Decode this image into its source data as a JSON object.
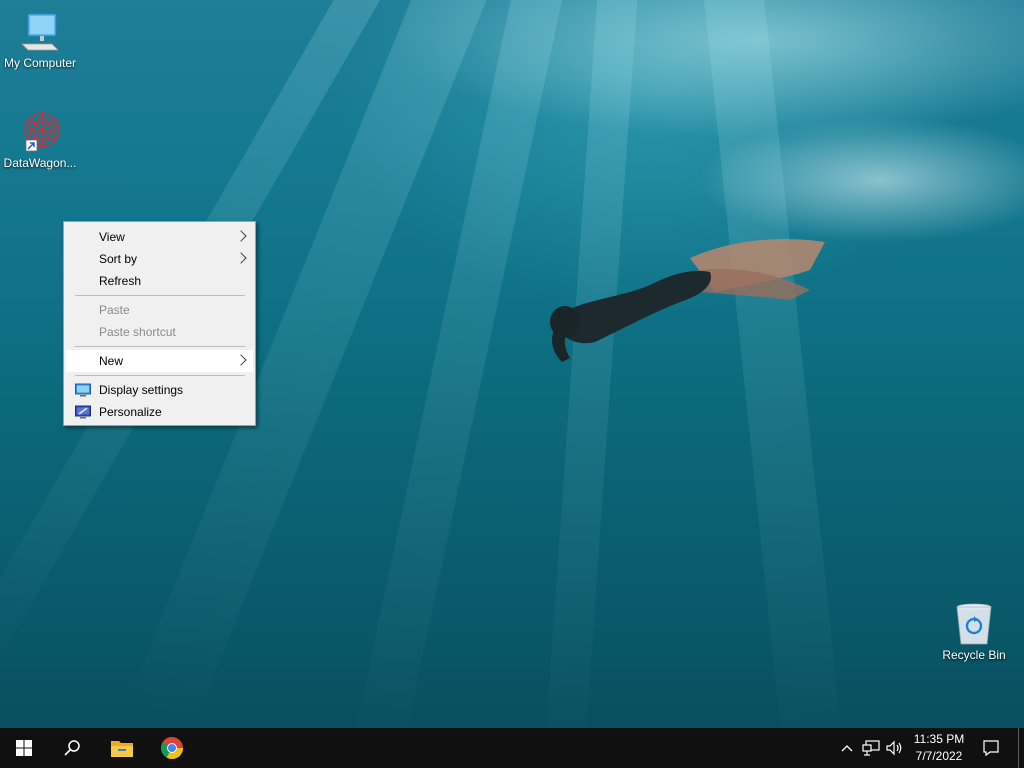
{
  "desktop": {
    "icons": [
      {
        "label": "My Computer"
      },
      {
        "label": "DataWagon..."
      },
      {
        "label": "Recycle Bin"
      }
    ]
  },
  "context_menu": {
    "items": {
      "view": "View",
      "sort_by": "Sort by",
      "refresh": "Refresh",
      "paste": "Paste",
      "paste_shortcut": "Paste shortcut",
      "new": "New",
      "display_settings": "Display settings",
      "personalize": "Personalize"
    }
  },
  "taskbar": {
    "icons": [
      "windows-start-icon",
      "search-icon",
      "file-explorer-icon",
      "chrome-icon"
    ],
    "tray": [
      "chevron-up-icon",
      "network-icon",
      "volume-icon",
      "notification-icon"
    ],
    "clock": {
      "time": "11:35 PM",
      "date": "7/7/2022"
    }
  },
  "colors": {
    "taskbar_bg": "#101010",
    "menu_bg": "#f0f0f0",
    "water_top": "#1f7e98",
    "water_bottom": "#084f5f"
  }
}
